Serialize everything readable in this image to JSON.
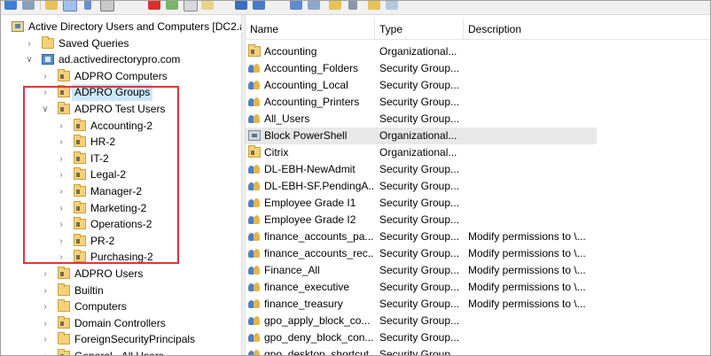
{
  "tree": [
    {
      "label": "Active Directory Users and Computers [DC2.a",
      "icon": "ad-console-icon",
      "indent": 0,
      "chevron": ""
    },
    {
      "label": "Saved Queries",
      "icon": "folder-icon",
      "indent": 1,
      "chevron": "right"
    },
    {
      "label": "ad.activedirectorypro.com",
      "icon": "domain-icon",
      "indent": 1,
      "chevron": "down"
    },
    {
      "label": "ADPRO Computers",
      "icon": "ou-icon",
      "indent": 2,
      "chevron": "right"
    },
    {
      "label": "ADPRO Groups",
      "icon": "ou-icon",
      "indent": 2,
      "chevron": "right",
      "selected": true
    },
    {
      "label": "ADPRO Test Users",
      "icon": "ou-icon",
      "indent": 2,
      "chevron": "down"
    },
    {
      "label": "Accounting-2",
      "icon": "ou-icon",
      "indent": 3,
      "chevron": "right"
    },
    {
      "label": "HR-2",
      "icon": "ou-icon",
      "indent": 3,
      "chevron": "right"
    },
    {
      "label": "IT-2",
      "icon": "ou-icon",
      "indent": 3,
      "chevron": "right"
    },
    {
      "label": "Legal-2",
      "icon": "ou-icon",
      "indent": 3,
      "chevron": "right"
    },
    {
      "label": "Manager-2",
      "icon": "ou-icon",
      "indent": 3,
      "chevron": "right"
    },
    {
      "label": "Marketing-2",
      "icon": "ou-icon",
      "indent": 3,
      "chevron": "right"
    },
    {
      "label": "Operations-2",
      "icon": "ou-icon",
      "indent": 3,
      "chevron": "right"
    },
    {
      "label": "PR-2",
      "icon": "ou-icon",
      "indent": 3,
      "chevron": "right"
    },
    {
      "label": "Purchasing-2",
      "icon": "ou-icon",
      "indent": 3,
      "chevron": "right"
    },
    {
      "label": "ADPRO Users",
      "icon": "ou-icon",
      "indent": 2,
      "chevron": "right"
    },
    {
      "label": "Builtin",
      "icon": "folder-icon",
      "indent": 2,
      "chevron": "right"
    },
    {
      "label": "Computers",
      "icon": "folder-icon",
      "indent": 2,
      "chevron": "right"
    },
    {
      "label": "Domain Controllers",
      "icon": "ou-icon",
      "indent": 2,
      "chevron": "right"
    },
    {
      "label": "ForeignSecurityPrincipals",
      "icon": "folder-icon",
      "indent": 2,
      "chevron": "right"
    },
    {
      "label": "General - All Users",
      "icon": "ou-icon",
      "indent": 2,
      "chevron": "right"
    }
  ],
  "columns": {
    "name": "Name",
    "type": "Type",
    "description": "Description"
  },
  "rows": [
    {
      "name": "Accounting",
      "type": "Organizational...",
      "description": "",
      "icon": "ou-icon"
    },
    {
      "name": "Accounting_Folders",
      "type": "Security Group...",
      "description": "",
      "icon": "group-icon"
    },
    {
      "name": "Accounting_Local",
      "type": "Security Group...",
      "description": "",
      "icon": "group-icon"
    },
    {
      "name": "Accounting_Printers",
      "type": "Security Group...",
      "description": "",
      "icon": "group-icon"
    },
    {
      "name": "All_Users",
      "type": "Security Group...",
      "description": "",
      "icon": "group-icon"
    },
    {
      "name": "Block PowerShell",
      "type": "Organizational...",
      "description": "",
      "icon": "gpo-icon",
      "highlight": true
    },
    {
      "name": "Citrix",
      "type": "Organizational...",
      "description": "",
      "icon": "ou-icon"
    },
    {
      "name": "DL-EBH-NewAdmit",
      "type": "Security Group...",
      "description": "",
      "icon": "group-icon"
    },
    {
      "name": "DL-EBH-SF.PendingA...",
      "type": "Security Group...",
      "description": "",
      "icon": "group-icon"
    },
    {
      "name": "Employee Grade I1",
      "type": "Security Group...",
      "description": "",
      "icon": "group-icon"
    },
    {
      "name": "Employee Grade I2",
      "type": "Security Group...",
      "description": "",
      "icon": "group-icon"
    },
    {
      "name": "finance_accounts_pa...",
      "type": "Security Group...",
      "description": "Modify permissions to \\...",
      "icon": "group-icon"
    },
    {
      "name": "finance_accounts_rec...",
      "type": "Security Group...",
      "description": "Modify permissions to \\...",
      "icon": "group-icon"
    },
    {
      "name": "Finance_All",
      "type": "Security Group...",
      "description": "Modify permissions to \\...",
      "icon": "group-icon"
    },
    {
      "name": "finance_executive",
      "type": "Security Group...",
      "description": "Modify permissions to \\...",
      "icon": "group-icon"
    },
    {
      "name": "finance_treasury",
      "type": "Security Group...",
      "description": "Modify permissions to \\...",
      "icon": "group-icon"
    },
    {
      "name": "gpo_apply_block_co...",
      "type": "Security Group...",
      "description": "",
      "icon": "group-icon"
    },
    {
      "name": "gpo_deny_block_con...",
      "type": "Security Group...",
      "description": "",
      "icon": "group-icon"
    },
    {
      "name": "gpo_desktop_shortcut",
      "type": "Security Group...",
      "description": "",
      "icon": "group-icon"
    }
  ],
  "colors": {
    "highlight_box": "#e0333a",
    "selection": "#cce8ff",
    "row_hover": "#e8e8e8"
  }
}
